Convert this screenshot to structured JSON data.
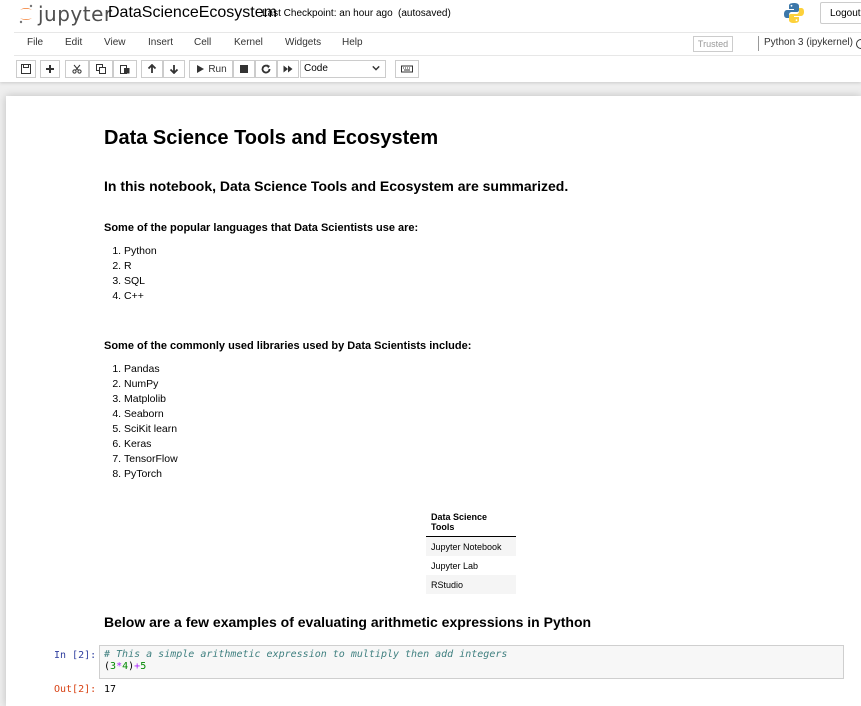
{
  "header": {
    "logo_text": "jupyter",
    "notebook_name": "DataScienceEcosystem",
    "checkpoint": "Last Checkpoint: an hour ago",
    "autosave": "(autosaved)",
    "logout_label": "Logout"
  },
  "menu": {
    "items": [
      "File",
      "Edit",
      "View",
      "Insert",
      "Cell",
      "Kernel",
      "Widgets",
      "Help"
    ],
    "trusted": "Trusted",
    "kernel": "Python 3 (ipykernel)"
  },
  "toolbar": {
    "run_label": "Run",
    "cell_type": "Code"
  },
  "notebook": {
    "title": "Data Science Tools and Ecosystem",
    "intro": "In this notebook, Data Science Tools and Ecosystem are summarized.",
    "languages_heading": "Some of the popular languages that Data Scientists use are:",
    "languages": [
      "Python",
      "R",
      "SQL",
      "C++"
    ],
    "libraries_heading": "Some of the commonly used libraries used by Data Scientists include:",
    "libraries": [
      "Pandas",
      "NumPy",
      "Matplolib",
      "Seaborn",
      "SciKit learn",
      "Keras",
      "TensorFlow",
      "PyTorch"
    ],
    "table": {
      "header": "Data Science Tools",
      "rows": [
        "Jupyter Notebook",
        "Jupyter Lab",
        "RStudio"
      ]
    },
    "arith_heading": "Below are a few examples of evaluating arithmetic expressions in Python",
    "code_cell": {
      "in_prompt": "In [2]:",
      "comment": "# This a simple arithmetic expression to multiply then add integers",
      "code_parts": [
        "(",
        "3",
        "*",
        "4",
        ")",
        "+",
        "5"
      ],
      "out_prompt": "Out[2]:",
      "output": "17"
    }
  }
}
